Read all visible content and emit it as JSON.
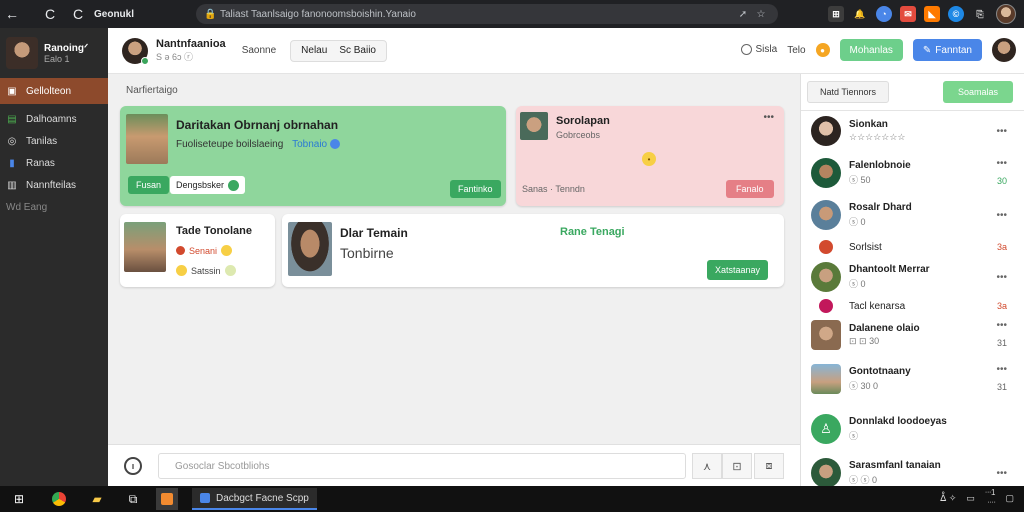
{
  "browser": {
    "tab_title": "Geonukl",
    "url": "Taliast Taanlsaigo fanonoomsboishin.Yanaio",
    "back": "←",
    "forward": "C",
    "reload": "C",
    "lock": "🔒",
    "addr_icon_1": "➚",
    "addr_icon_2": "☆"
  },
  "sidebar": {
    "profile_name": "Ranoingᐟ",
    "profile_sub": "Ealo 1",
    "items": [
      {
        "label": "Gellolteon",
        "icon": "▣",
        "active": true
      },
      {
        "label": "Dalhoamns",
        "icon": "▤"
      },
      {
        "label": "Tanilas",
        "icon": "◎"
      },
      {
        "label": "Ranas",
        "icon": "▮"
      },
      {
        "label": "Nannfteilas",
        "icon": "▥"
      },
      {
        "label": "Wd Eang",
        "icon": "",
        "dim": true
      }
    ]
  },
  "header": {
    "name": "Nantnfaanioa",
    "sub": "S ə 6ɔ ⓡ",
    "link": "Saonne",
    "pill_left": "Nelau",
    "pill_right": "Sc Baiio",
    "right_radio": "Sisla",
    "right_text": "Telo",
    "btn_green": "Mohanlas",
    "btn_blue": "Fanntan"
  },
  "content": {
    "section_title": "Narfiertaigo",
    "card1": {
      "title": "Daritakan Obrnanj obrnahan",
      "subtitle": "Fuoliseteupe boilslaeing",
      "subtitle_link": "Tobnaio",
      "badge1": "Fusan",
      "badge2": "Dengsbsker",
      "action": "Fantinko"
    },
    "card2": {
      "title": "Sorolapan",
      "subtitle": "Gobrceobs",
      "more": "•••",
      "footer": "Sanas · Tenndn",
      "action": "Fanalo"
    },
    "card3": {
      "title": "Tade Tonolane",
      "line1": "Senani",
      "line2": "Satssin"
    },
    "card4": {
      "title": "Dlar Temain",
      "subtitle": "Tonbirne",
      "center": "Rane Tenagi",
      "action": "Xatstaanay"
    },
    "composer_placeholder": "Gosoclar Sbcotbliohs"
  },
  "right": {
    "pill": "Natd Tiennors",
    "btn": "Soamalas",
    "contacts": [
      {
        "name": "Sionkan",
        "meta": "☆☆☆☆☆☆☆",
        "right": "•••",
        "num": ""
      },
      {
        "name": "Falenlobnoie",
        "meta": "ⓢ 50",
        "right": "•••",
        "num": "30"
      },
      {
        "name": "Rosalr Dhard",
        "meta": "ⓢ 0",
        "right": "•••",
        "num": ""
      },
      {
        "name": "Sorlsist",
        "meta": "",
        "right": "",
        "num": "3a"
      },
      {
        "name": "Dhantoolt Merrar",
        "meta": "ⓢ 0",
        "right": "•••",
        "num": ""
      },
      {
        "name": "Tacl kenarsa",
        "meta": "",
        "right": "",
        "num": "3a"
      },
      {
        "name": "Dalanene olaio",
        "meta": "⊡ ⊡ 30",
        "right": "•••",
        "num": "31"
      },
      {
        "name": "Gontotnaany",
        "meta": "ⓢ 30 0",
        "right": "•••",
        "num": "31"
      },
      {
        "name": "Donnlakd loodoeyas",
        "meta": "ⓢ",
        "right": "",
        "num": ""
      },
      {
        "name": "Sarasmfanl tanaian",
        "meta": "ⓢ ⓢ 0",
        "right": "•••",
        "num": ""
      }
    ]
  },
  "taskbar": {
    "app_label": "Dacbgct Facne Scpp",
    "clock_time": "ᐧᐧᐧ1",
    "clock_date": "ᐧᐧᐧᐧ",
    "tray": "ᐂ ✧"
  }
}
